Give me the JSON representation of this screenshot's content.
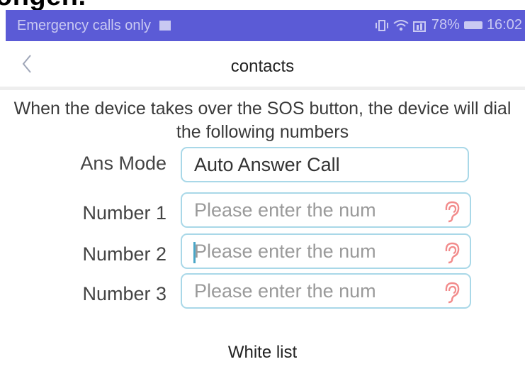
{
  "top_caption": "ongen.",
  "status_bar": {
    "carrier": "Emergency calls only",
    "battery_percent": "78%",
    "time": "16:02"
  },
  "header": {
    "back_icon": "chevron-left-icon",
    "title": "contacts"
  },
  "description": "When the device takes over the SOS button, the device will dial the following numbers",
  "ans_mode": {
    "label": "Ans Mode",
    "value": "Auto Answer Call"
  },
  "numbers": [
    {
      "label": "Number 1",
      "placeholder": "Please enter the num",
      "value": ""
    },
    {
      "label": "Number 2",
      "placeholder": "Please enter the num",
      "value": ""
    },
    {
      "label": "Number 3",
      "placeholder": "Please enter the num",
      "value": ""
    }
  ],
  "white_list": "White list",
  "colors": {
    "status_bar": "#5b5bd6",
    "field_border": "#a9d8e8",
    "ear_icon": "#f28b8b"
  }
}
